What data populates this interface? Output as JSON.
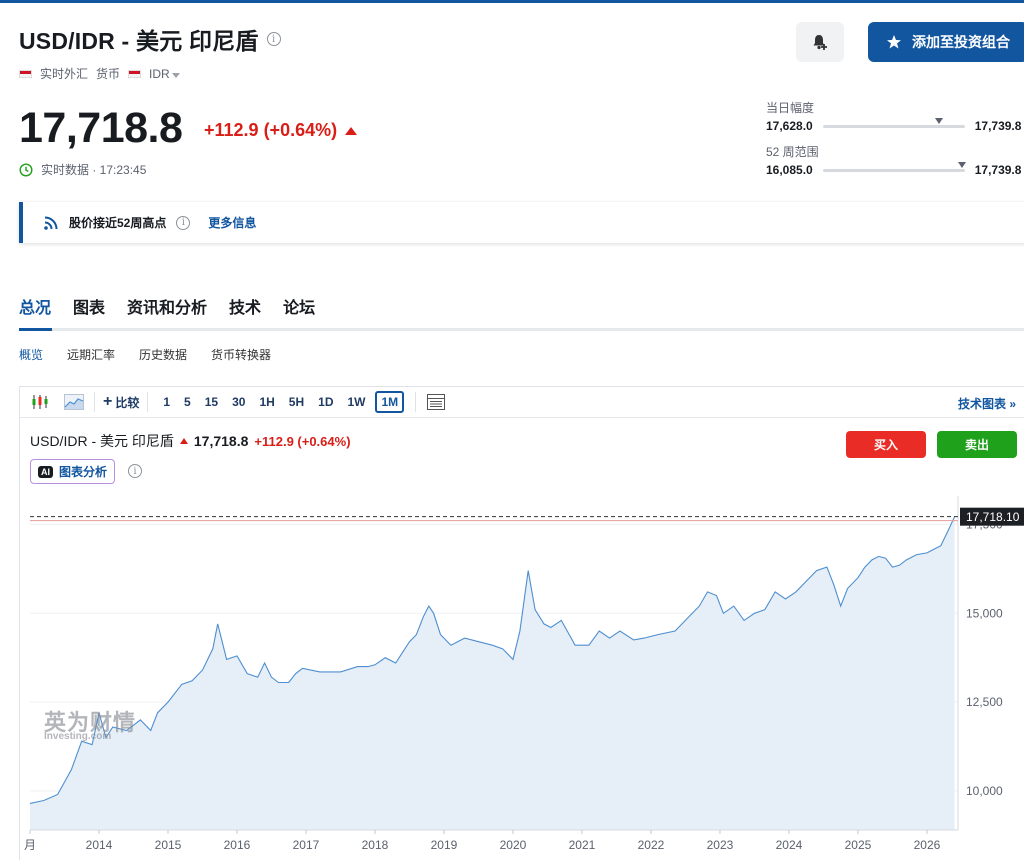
{
  "header": {
    "title": "USD/IDR - 美元 印尼盾",
    "meta_realtime": "实时外汇",
    "meta_type": "货币",
    "meta_currency": "IDR",
    "add_portfolio": "添加至投资组合"
  },
  "quote": {
    "price": "17,718.8",
    "change": "+112.9 (+0.64%)",
    "realtime_label": "实时数据 · 17:23:45"
  },
  "ranges": {
    "day_label": "当日幅度",
    "day_low": "17,628.0",
    "day_high": "17,739.8",
    "day_position": 0.82,
    "week52_label": "52 周范围",
    "week52_low": "16,085.0",
    "week52_high": "17,739.8",
    "week52_position": 0.98
  },
  "alert": {
    "text": "股价接近52周高点",
    "more": "更多信息"
  },
  "tabs": [
    "总况",
    "图表",
    "资讯和分析",
    "技术",
    "论坛"
  ],
  "subtabs": [
    "概览",
    "远期汇率",
    "历史数据",
    "货币转换器"
  ],
  "toolbar": {
    "compare": "比较",
    "timeframes": [
      "1",
      "5",
      "15",
      "30",
      "1H",
      "5H",
      "1D",
      "1W",
      "1M"
    ],
    "active_timeframe": "1M",
    "tech_chart": "技术图表 »"
  },
  "chart_header": {
    "pair": "USD/IDR - 美元 印尼盾",
    "price": "17,718.8",
    "change": "+112.9 (+0.64%)",
    "ai_badge": "AI",
    "ai_label": "图表分析",
    "buy": "买入",
    "sell": "卖出"
  },
  "watermark": {
    "cn": "英为财情",
    "en": "Investing.com"
  },
  "chart_data": {
    "type": "area",
    "title": "",
    "xlabel": "",
    "ylabel": "",
    "series_color": "#4d8fd0",
    "fill_color": "#e6eef7",
    "ylim": [
      8900,
      18300
    ],
    "xlim": [
      2013.0,
      2026.45
    ],
    "y_ticks": [
      10000,
      12500,
      15000,
      17500
    ],
    "y_tick_labels": [
      "10,000",
      "12,500",
      "15,000",
      "17,500"
    ],
    "x_ticks": [
      2013.0,
      2014,
      2015,
      2016,
      2017,
      2018,
      2019,
      2020,
      2021,
      2022,
      2023,
      2024,
      2025,
      2026
    ],
    "x_tick_labels": [
      "月",
      "2014",
      "2015",
      "2016",
      "2017",
      "2018",
      "2019",
      "2020",
      "2021",
      "2022",
      "2023",
      "2024",
      "2025",
      "2026"
    ],
    "last_value_label": "17,718.10",
    "last_value": 17718.1,
    "points": [
      [
        2013.0,
        9650
      ],
      [
        2013.2,
        9730
      ],
      [
        2013.4,
        9900
      ],
      [
        2013.6,
        10600
      ],
      [
        2013.75,
        11400
      ],
      [
        2013.9,
        11300
      ],
      [
        2014.0,
        12200
      ],
      [
        2014.1,
        11500
      ],
      [
        2014.2,
        11800
      ],
      [
        2014.4,
        11700
      ],
      [
        2014.6,
        12000
      ],
      [
        2014.75,
        11700
      ],
      [
        2014.85,
        12200
      ],
      [
        2015.0,
        12500
      ],
      [
        2015.2,
        13000
      ],
      [
        2015.35,
        13100
      ],
      [
        2015.5,
        13400
      ],
      [
        2015.65,
        14000
      ],
      [
        2015.72,
        14700
      ],
      [
        2015.85,
        13700
      ],
      [
        2016.0,
        13800
      ],
      [
        2016.15,
        13300
      ],
      [
        2016.3,
        13200
      ],
      [
        2016.4,
        13600
      ],
      [
        2016.5,
        13200
      ],
      [
        2016.6,
        13050
      ],
      [
        2016.75,
        13050
      ],
      [
        2016.85,
        13300
      ],
      [
        2016.95,
        13450
      ],
      [
        2017.2,
        13350
      ],
      [
        2017.5,
        13350
      ],
      [
        2017.75,
        13500
      ],
      [
        2017.9,
        13500
      ],
      [
        2018.0,
        13550
      ],
      [
        2018.15,
        13750
      ],
      [
        2018.3,
        13600
      ],
      [
        2018.4,
        13900
      ],
      [
        2018.5,
        14200
      ],
      [
        2018.6,
        14400
      ],
      [
        2018.7,
        14900
      ],
      [
        2018.78,
        15200
      ],
      [
        2018.85,
        15000
      ],
      [
        2018.95,
        14400
      ],
      [
        2019.1,
        14100
      ],
      [
        2019.3,
        14300
      ],
      [
        2019.5,
        14200
      ],
      [
        2019.7,
        14100
      ],
      [
        2019.85,
        14000
      ],
      [
        2020.0,
        13700
      ],
      [
        2020.1,
        14500
      ],
      [
        2020.22,
        16200
      ],
      [
        2020.32,
        15100
      ],
      [
        2020.45,
        14700
      ],
      [
        2020.55,
        14600
      ],
      [
        2020.7,
        14800
      ],
      [
        2020.9,
        14100
      ],
      [
        2021.1,
        14100
      ],
      [
        2021.25,
        14500
      ],
      [
        2021.4,
        14300
      ],
      [
        2021.55,
        14500
      ],
      [
        2021.75,
        14250
      ],
      [
        2021.9,
        14300
      ],
      [
        2022.1,
        14400
      ],
      [
        2022.35,
        14500
      ],
      [
        2022.55,
        14900
      ],
      [
        2022.7,
        15200
      ],
      [
        2022.82,
        15600
      ],
      [
        2022.95,
        15500
      ],
      [
        2023.05,
        15000
      ],
      [
        2023.2,
        15200
      ],
      [
        2023.35,
        14800
      ],
      [
        2023.5,
        15000
      ],
      [
        2023.65,
        15100
      ],
      [
        2023.8,
        15600
      ],
      [
        2023.95,
        15400
      ],
      [
        2024.1,
        15600
      ],
      [
        2024.25,
        15900
      ],
      [
        2024.4,
        16200
      ],
      [
        2024.55,
        16300
      ],
      [
        2024.65,
        15800
      ],
      [
        2024.75,
        15200
      ],
      [
        2024.85,
        15700
      ],
      [
        2025.0,
        16000
      ],
      [
        2025.1,
        16300
      ],
      [
        2025.2,
        16500
      ],
      [
        2025.3,
        16600
      ],
      [
        2025.4,
        16550
      ],
      [
        2025.5,
        16300
      ],
      [
        2025.6,
        16350
      ],
      [
        2025.7,
        16500
      ],
      [
        2025.85,
        16650
      ],
      [
        2026.0,
        16700
      ],
      [
        2026.1,
        16800
      ],
      [
        2026.2,
        16900
      ],
      [
        2026.3,
        17300
      ],
      [
        2026.4,
        17718
      ]
    ]
  }
}
